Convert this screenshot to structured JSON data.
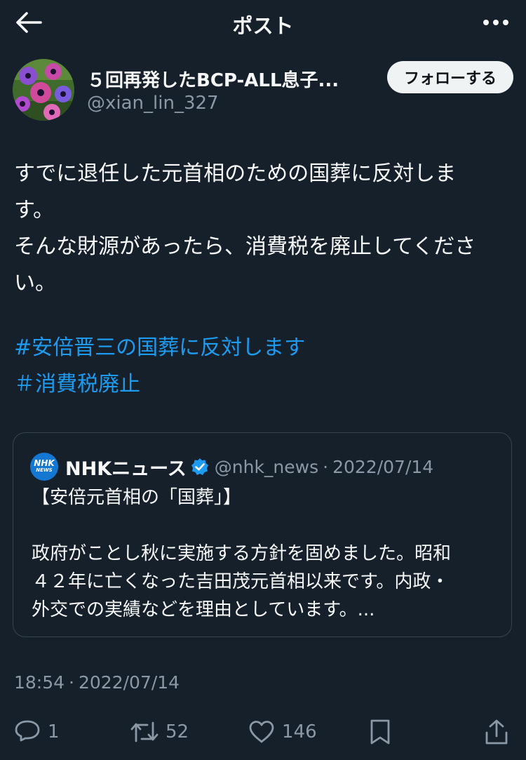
{
  "header": {
    "title": "ポスト"
  },
  "author": {
    "display_name": "５回再発したBCP-ALL息子...",
    "handle": "@xian_lin_327",
    "follow_label": "フォローする"
  },
  "post": {
    "lines": [
      "すでに退任した元首相のための国葬に反対しま",
      "す。",
      "そんな財源があったら、消費税を廃止してくださ",
      "い。"
    ],
    "hashtags": [
      "#安倍晋三の国葬に反対します",
      "＃消費税廃止"
    ]
  },
  "quote": {
    "logo_line1": "NHK",
    "logo_line2": "NEWS",
    "name": "NHKニュース",
    "handle": "@nhk_news",
    "sep": "·",
    "date": "2022/07/14",
    "title": "【安倍元首相の「国葬」】",
    "body_lines": [
      "政府がことし秋に実施する方針を固めました。昭和",
      "４２年に亡くなった吉田茂元首相以来です。内政・",
      "外交での実績などを理由としています。..."
    ]
  },
  "meta": {
    "time": "18:54",
    "sep": "·",
    "date": "2022/07/14"
  },
  "actions": {
    "replies": "1",
    "reposts": "52",
    "likes": "146"
  },
  "colors": {
    "background": "#15202b",
    "text": "#f7f9f9",
    "muted": "#8b98a5",
    "link": "#1d9bf0",
    "border": "#38444d",
    "verified": "#1d9bf0"
  }
}
